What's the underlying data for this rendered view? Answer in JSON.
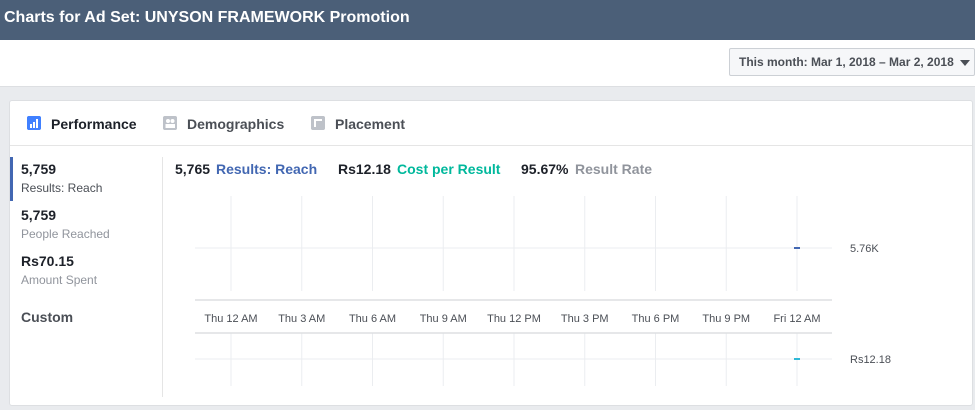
{
  "header": {
    "title": "Charts for Ad Set: UNYSON FRAMEWORK Promotion"
  },
  "toolbar": {
    "date_range_label": "This month: Mar 1, 2018 – Mar 2, 2018"
  },
  "tabs": [
    {
      "label": "Performance",
      "icon": "bar-chart-icon",
      "active": true
    },
    {
      "label": "Demographics",
      "icon": "people-icon",
      "active": false
    },
    {
      "label": "Placement",
      "icon": "placement-icon",
      "active": false
    }
  ],
  "sidebar": {
    "metrics": [
      {
        "value": "5,759",
        "label": "Results: Reach",
        "active": true
      },
      {
        "value": "5,759",
        "label": "People Reached",
        "active": false
      },
      {
        "value": "Rs70.15",
        "label": "Amount Spent",
        "active": false
      }
    ],
    "custom_label": "Custom"
  },
  "summary": {
    "results_value": "5,765",
    "results_label": "Results: Reach",
    "cost_value": "Rs12.18",
    "cost_label": "Cost per Result",
    "rate_value": "95.67%",
    "rate_label": "Result Rate"
  },
  "colors": {
    "results": "#4267b2",
    "cost": "#00b89c",
    "rate": "#90949c",
    "header_bg": "#4b5f78",
    "point_results": "#4267b2",
    "point_cost": "#2eb8d6"
  },
  "chart_data": [
    {
      "type": "line",
      "x": [
        "Thu 12 AM",
        "Thu 3 AM",
        "Thu 6 AM",
        "Thu 9 AM",
        "Thu 12 PM",
        "Thu 3 PM",
        "Thu 6 PM",
        "Thu 9 PM",
        "Fri 12 AM"
      ],
      "series": [
        {
          "name": "Results: Reach",
          "points": [
            {
              "x": "Fri 12 AM",
              "y": 5760
            }
          ]
        }
      ],
      "y_tick_label": "5.76K",
      "grid": true
    },
    {
      "type": "line",
      "x": [
        "Thu 12 AM",
        "Thu 3 AM",
        "Thu 6 AM",
        "Thu 9 AM",
        "Thu 12 PM",
        "Thu 3 PM",
        "Thu 6 PM",
        "Thu 9 PM",
        "Fri 12 AM"
      ],
      "series": [
        {
          "name": "Cost per Result",
          "points": [
            {
              "x": "Fri 12 AM",
              "y": 12.18
            }
          ]
        }
      ],
      "y_tick_label": "Rs12.18",
      "grid": true
    }
  ]
}
